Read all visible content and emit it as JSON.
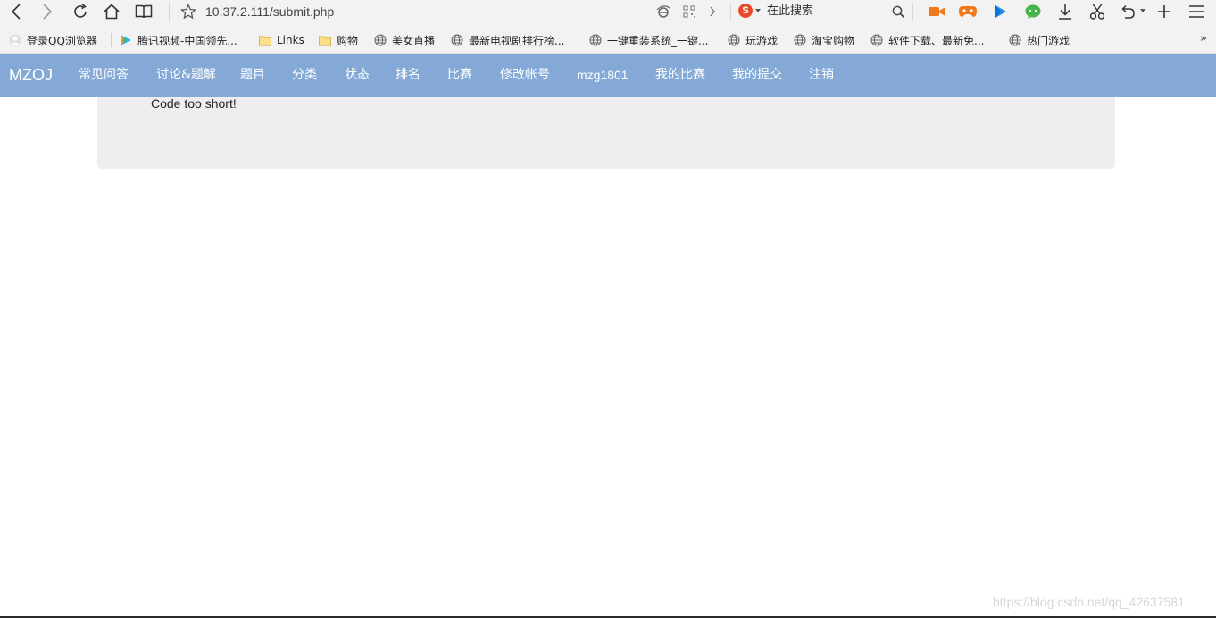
{
  "browser": {
    "url": "10.37.2.111/submit.php",
    "search_placeholder": "在此搜索",
    "search_engine_icon": "sogou-icon",
    "colors": {
      "toolbar_bg": "#f2f2f2"
    }
  },
  "bookmarks": {
    "items": [
      {
        "label": "登录QQ浏览器",
        "icon": "user-avatar-icon"
      },
      {
        "label": "腾讯视频-中国领先...",
        "icon": "tencent-video-icon"
      },
      {
        "label": "Links",
        "icon": "folder-icon"
      },
      {
        "label": "购物",
        "icon": "folder-icon"
      },
      {
        "label": "美女直播",
        "icon": "globe-icon"
      },
      {
        "label": "最新电视剧排行榜...",
        "icon": "globe-icon"
      },
      {
        "label": "一键重装系统_一键...",
        "icon": "globe-icon"
      },
      {
        "label": "玩游戏",
        "icon": "globe-icon"
      },
      {
        "label": "淘宝购物",
        "icon": "globe-icon"
      },
      {
        "label": "软件下载、最新免...",
        "icon": "globe-icon"
      },
      {
        "label": "热门游戏",
        "icon": "globe-icon"
      }
    ],
    "more": "»"
  },
  "navbar": {
    "brand": "MZOJ",
    "color": "#84a9d7",
    "items": [
      {
        "label": "常见问答"
      },
      {
        "label": "讨论&题解"
      },
      {
        "label": "题目"
      },
      {
        "label": "分类"
      },
      {
        "label": "状态"
      },
      {
        "label": "排名"
      },
      {
        "label": "比赛"
      },
      {
        "label": "修改帐号"
      },
      {
        "label": "mzg1801"
      },
      {
        "label": "我的比赛"
      },
      {
        "label": "我的提交"
      },
      {
        "label": "注销"
      }
    ]
  },
  "content": {
    "message": "Code too short!"
  },
  "watermark": "https://blog.csdn.net/qq_42637581"
}
